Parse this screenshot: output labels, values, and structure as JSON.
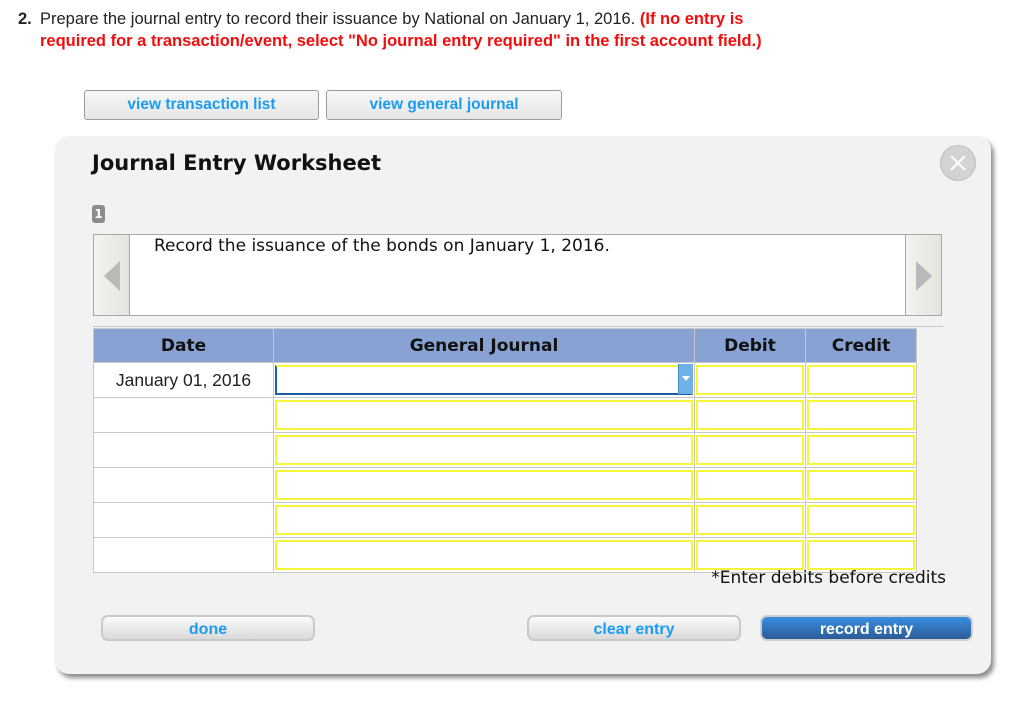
{
  "question": {
    "number": "2.",
    "text": "Prepare the journal entry to record their issuance by National on January 1, 2016.",
    "note_part1": "(If no entry is",
    "note_part2": "required for a transaction/event, select \"No journal entry required\" in the first account field.)"
  },
  "top_buttons": {
    "view_transaction_list": "view transaction list",
    "view_general_journal": "view general journal"
  },
  "worksheet": {
    "title": "Journal Entry Worksheet",
    "close_icon": "close-icon",
    "step": "1",
    "prompt": "Record the issuance of the bonds on January 1, 2016.",
    "prev_icon": "triangle-left-icon",
    "next_icon": "triangle-right-icon",
    "table": {
      "headers": [
        "Date",
        "General Journal",
        "Debit",
        "Credit"
      ],
      "rows": [
        {
          "date": "January 01, 2016",
          "account": "",
          "debit": "",
          "credit": ""
        },
        {
          "date": "",
          "account": "",
          "debit": "",
          "credit": ""
        },
        {
          "date": "",
          "account": "",
          "debit": "",
          "credit": ""
        },
        {
          "date": "",
          "account": "",
          "debit": "",
          "credit": ""
        },
        {
          "date": "",
          "account": "",
          "debit": "",
          "credit": ""
        },
        {
          "date": "",
          "account": "",
          "debit": "",
          "credit": ""
        }
      ]
    },
    "hint": "*Enter debits before credits",
    "buttons": {
      "done": "done",
      "clear_entry": "clear entry",
      "record_entry": "record entry"
    }
  },
  "colors": {
    "note_red": "#f20d0d",
    "link_blue": "#1a9cf0",
    "header_blue": "#87a2d3",
    "input_border_yellow": "#f5f53a",
    "record_button_blue": "#2b5b97"
  }
}
